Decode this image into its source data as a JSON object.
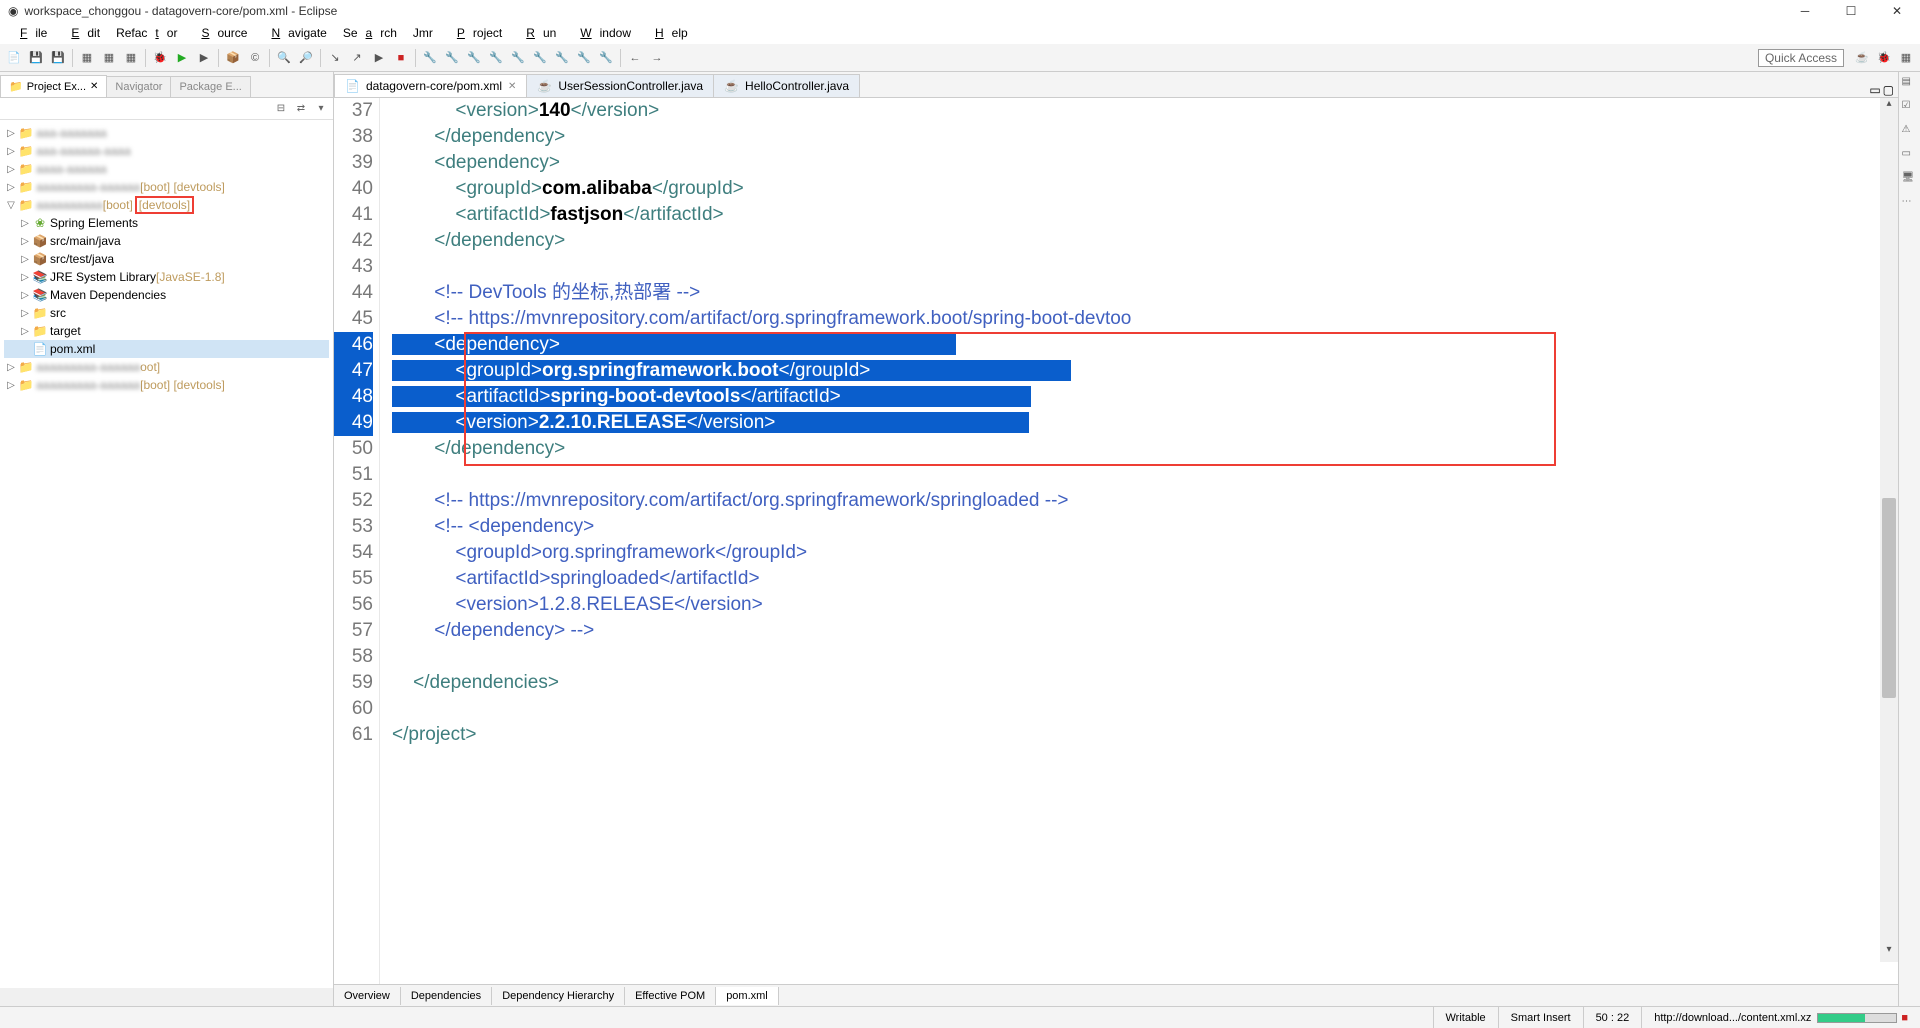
{
  "window": {
    "title": "workspace_chonggou - datagovern-core/pom.xml - Eclipse"
  },
  "menu": {
    "file": "File",
    "edit": "Edit",
    "refactor": "Refactor",
    "source": "Source",
    "navigate": "Navigate",
    "search": "Search",
    "jmr": "Jmr",
    "project": "Project",
    "run": "Run",
    "window": "Window",
    "help": "Help"
  },
  "toolbar": {
    "quick_access": "Quick Access"
  },
  "left": {
    "tabs": {
      "project_explorer": "Project Ex...",
      "navigator": "Navigator",
      "package_explorer": "Package E..."
    },
    "tree": {
      "p1_suffix": "[boot] [devtools]",
      "p2_suffix_boot": "[boot]",
      "p2_devtools": "[devtools]",
      "spring_elements": "Spring Elements",
      "src_main_java": "src/main/java",
      "src_test_java": "src/test/java",
      "jre": "JRE System Library",
      "jre_suffix": "[JavaSE-1.8]",
      "maven_deps": "Maven Dependencies",
      "src": "src",
      "target": "target",
      "pom": "pom.xml",
      "p3_suffix": "oot]",
      "p4_suffix": "[boot] [devtools]"
    }
  },
  "editor": {
    "tabs": {
      "pom": "datagovern-core/pom.xml",
      "user": "UserSessionController.java",
      "hello": "HelloController.java"
    },
    "bottom_tabs": {
      "overview": "Overview",
      "deps": "Dependencies",
      "hier": "Dependency Hierarchy",
      "eff": "Effective POM",
      "pom": "pom.xml"
    },
    "lines": {
      "37": {
        "n": "37",
        "pre": "            ",
        "t1": "<version>",
        "v": "140",
        "t2": "</version>"
      },
      "38": {
        "n": "38",
        "pre": "        ",
        "t": "</dependency>"
      },
      "39": {
        "n": "39",
        "pre": "        ",
        "t": "<dependency>"
      },
      "40": {
        "n": "40",
        "pre": "            ",
        "t1": "<groupId>",
        "v": "com.alibaba",
        "t2": "</groupId>"
      },
      "41": {
        "n": "41",
        "pre": "            ",
        "t1": "<artifactId>",
        "v": "fastjson",
        "t2": "</artifactId>"
      },
      "42": {
        "n": "42",
        "pre": "        ",
        "t": "</dependency>"
      },
      "43": {
        "n": "43"
      },
      "44": {
        "n": "44",
        "pre": "        ",
        "c": "<!-- DevTools 的坐标,热部署 -->"
      },
      "45": {
        "n": "45",
        "pre": "        ",
        "c": "<!-- https://mvnrepository.com/artifact/org.springframework.boot/spring-boot-devtoo"
      },
      "46": {
        "n": "46",
        "pre": "        ",
        "t": "<dependency>"
      },
      "47": {
        "n": "47",
        "pre": "            ",
        "t1": "<groupId>",
        "v": "org.springframework.boot",
        "t2": "</groupId>"
      },
      "48": {
        "n": "48",
        "pre": "            ",
        "t1": "<artifactId>",
        "v": "spring-boot-devtools",
        "t2": "</artifactId>"
      },
      "49": {
        "n": "49",
        "pre": "            ",
        "t1": "<version>",
        "v": "2.2.10.RELEASE",
        "t2": "</version>"
      },
      "50": {
        "n": "50",
        "pre": "        ",
        "t": "</dependency>"
      },
      "51": {
        "n": "51"
      },
      "52": {
        "n": "52",
        "pre": "        ",
        "c": "<!-- https://mvnrepository.com/artifact/org.springframework/springloaded -->"
      },
      "53": {
        "n": "53",
        "pre": "        ",
        "c": "<!-- <dependency>"
      },
      "54": {
        "n": "54",
        "pre": "            ",
        "c": "<groupId>org.springframework</groupId>"
      },
      "55": {
        "n": "55",
        "pre": "            ",
        "c": "<artifactId>springloaded</artifactId>"
      },
      "56": {
        "n": "56",
        "pre": "            ",
        "c": "<version>1.2.8.RELEASE</version>"
      },
      "57": {
        "n": "57",
        "pre": "        ",
        "c": "</dependency> -->"
      },
      "58": {
        "n": "58"
      },
      "59": {
        "n": "59",
        "pre": "    ",
        "t": "</dependencies>"
      },
      "60": {
        "n": "60"
      },
      "61": {
        "n": "61",
        "t": "</project>"
      }
    }
  },
  "status": {
    "writable": "Writable",
    "insert": "Smart Insert",
    "pos": "50 : 22",
    "download": "http://download.../content.xml.xz"
  }
}
